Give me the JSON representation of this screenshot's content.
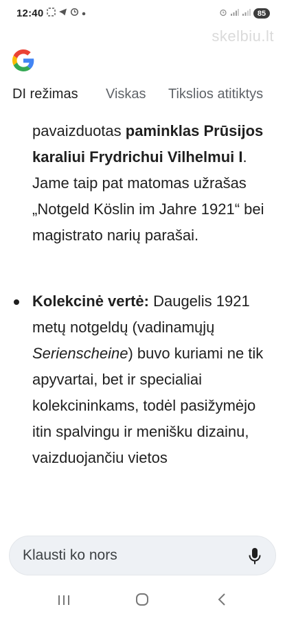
{
  "status_bar": {
    "time": "12:40",
    "left_icons": [
      "screenshot-icon",
      "telegram-icon",
      "sync-icon",
      "dot-icon"
    ],
    "right_icons": [
      "alarm-icon",
      "signal-icon",
      "signal-icon"
    ],
    "battery": "85"
  },
  "watermark": "skelbiu.lt",
  "tabs": [
    {
      "label": "DI režimas",
      "active": true
    },
    {
      "label": "Viskas",
      "active": false
    },
    {
      "label": "Tikslios atitiktys",
      "active": false
    }
  ],
  "content": {
    "paragraph1": {
      "text_a": "pavaizduotas ",
      "bold_a": "paminklas Prūsijos karaliui Frydrichui Vilhelmui I",
      "text_b": ". Jame taip pat matomas užrašas „Notgeld Köslin im Jahre 1921“ bei magistrato narių parašai."
    },
    "paragraph2": {
      "bold_a": "Kolekcinė vertė:",
      "text_a": " Daugelis 1921 metų notgeldų (vadinamųjų ",
      "italic_a": "Serienscheine",
      "text_b": ") buvo kuriami ne tik apyvartai, bet ir specialiai kolekcininkams, todėl pasižymėjo itin spalvingu ir menišku dizainu, vaizduojančiu vietos"
    }
  },
  "ask_bar": {
    "placeholder": "Klausti ko nors",
    "icon": "mic-icon"
  },
  "navbar": {
    "icons": [
      "recent-apps-icon",
      "home-icon",
      "back-icon"
    ]
  },
  "colors": {
    "text": "#1f1f1f",
    "muted": "#5f6368",
    "ask_bar_bg": "#eef1f5",
    "google_blue": "#4285F4",
    "google_red": "#EA4335",
    "google_yellow": "#FBBC05",
    "google_green": "#34A853"
  }
}
